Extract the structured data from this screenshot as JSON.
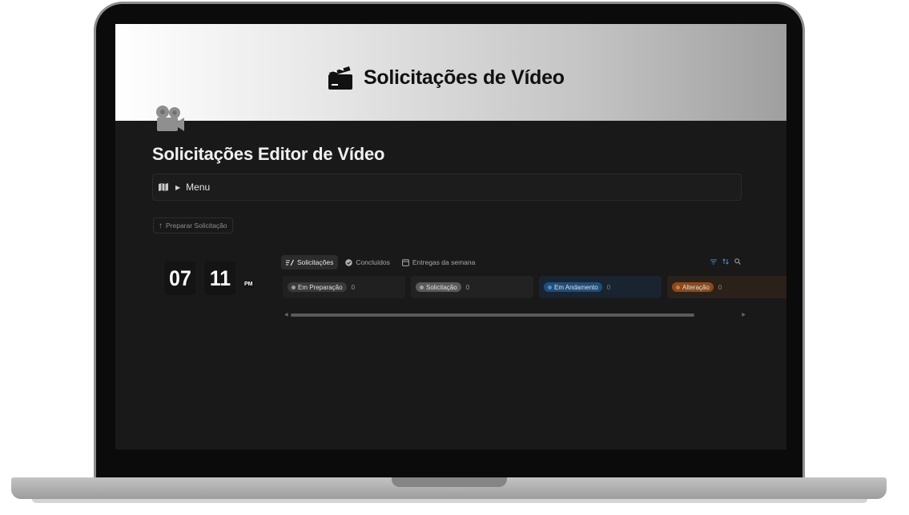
{
  "cover": {
    "title": "Solicitações de Vídeo",
    "icon": "clapperboard-icon"
  },
  "page": {
    "icon": "movie-camera-icon",
    "title": "Solicitações Editor de Vídeo"
  },
  "callout": {
    "icon": "map-icon",
    "toggle_label": "Menu"
  },
  "prepare_button": {
    "icon": "arrow-up-icon",
    "label": "Preparar Solicitação"
  },
  "clock": {
    "hours": "07",
    "minutes": "11",
    "period": "PM"
  },
  "database": {
    "tabs": [
      {
        "label": "Solicitações",
        "icon": "list-edit-icon",
        "active": true
      },
      {
        "label": "Concluídos",
        "icon": "check-circle-icon",
        "active": false
      },
      {
        "label": "Entregas da semana",
        "icon": "calendar-icon",
        "active": false
      }
    ],
    "tools": [
      "filter-icon",
      "sort-icon",
      "search-icon"
    ],
    "columns": [
      {
        "label": "Em Preparação",
        "count": "0",
        "pill_bg": "#3a3a3a",
        "dot": "#9b9b9b",
        "col_bg": "#202020",
        "count_color": "#9a9a9a"
      },
      {
        "label": "Solicitação",
        "count": "0",
        "pill_bg": "#5a5a5a",
        "dot": "#a0a0a0",
        "col_bg": "#222222",
        "count_color": "#9a9a9a"
      },
      {
        "label": "Em Andamento",
        "count": "0",
        "pill_bg": "#1f4e7a",
        "dot": "#4c8fd1",
        "col_bg": "#1a2330",
        "count_color": "#4c8fd1"
      },
      {
        "label": "Alteração",
        "count": "0",
        "pill_bg": "#8a4a1c",
        "dot": "#d27a3c",
        "col_bg": "#2a211b",
        "count_color": "#c07a45"
      }
    ]
  },
  "colors": {
    "accent_blue": "#4c8fd1",
    "background": "#191919"
  }
}
